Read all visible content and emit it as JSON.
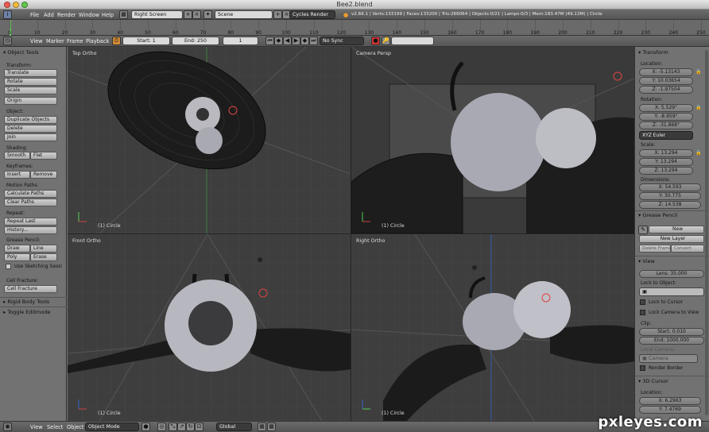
{
  "window": {
    "title": "Bee2.blend"
  },
  "top_menu": [
    "File",
    "Add",
    "Render",
    "Window",
    "Help"
  ],
  "screen_layout": "Right Screen",
  "scene": "Scene",
  "render_engine": "Cycles Render",
  "stats": "v2.66.1 | Verts:133199 | Faces:133200 | Tris:266064 | Objects:0/21 | Lamps:0/3 | Mem:183.47M (49.13M) | Circle",
  "timeline": {
    "ticks": [
      "0",
      "10",
      "20",
      "30",
      "40",
      "50",
      "60",
      "70",
      "80",
      "90",
      "100",
      "110",
      "120",
      "130",
      "140",
      "150",
      "160",
      "170",
      "180",
      "190",
      "200",
      "210",
      "220",
      "230",
      "240",
      "250"
    ],
    "menu": [
      "View",
      "Marker",
      "Frame",
      "Playback"
    ],
    "start": "Start: 1",
    "end": "End: 250",
    "current": "1",
    "sync": "No Sync"
  },
  "toolshelf": {
    "header": "Object Tools",
    "transform_label": "Transform:",
    "translate": "Translate",
    "rotate": "Rotate",
    "scale": "Scale",
    "origin": "Origin",
    "object_label": "Object:",
    "duplicate": "Duplicate Objects",
    "delete": "Delete",
    "join": "Join",
    "shading_label": "Shading:",
    "smooth": "Smooth",
    "flat": "Flat",
    "keyframes_label": "Keyframes:",
    "insert": "Insert",
    "remove": "Remove",
    "motion_label": "Motion Paths:",
    "calc_paths": "Calculate Paths",
    "clear_paths": "Clear Paths",
    "repeat_label": "Repeat:",
    "repeat_last": "Repeat Last",
    "history": "History...",
    "grease_label": "Grease Pencil:",
    "draw": "Draw",
    "line": "Line",
    "poly": "Poly",
    "erase": "Erase",
    "sketch": "Use Sketching Sessi",
    "cell_label": "Cell Fracture:",
    "cell_btn": "Cell Fracture",
    "rigid": "Rigid Body Tools",
    "toggle_edit": "Toggle Editmode"
  },
  "viewports": {
    "tl": {
      "label": "Top Ortho",
      "footer": "(1) Circle"
    },
    "tr": {
      "label": "Camera Persp",
      "footer": "(1) Circle"
    },
    "bl": {
      "label": "Front Ortho",
      "footer": "(1) Circle"
    },
    "br": {
      "label": "Right Ortho",
      "footer": "(1) Circle"
    }
  },
  "properties": {
    "transform_head": "Transform",
    "location_label": "Location:",
    "loc_x": "X: -5.13143",
    "loc_y": "Y: 10.03654",
    "loc_z": "Z: -1.97504",
    "rotation_label": "Rotation:",
    "rot_x": "X: 5.529°",
    "rot_y": "Y: -8.959°",
    "rot_z": "Z: -31.868°",
    "rot_mode": "XYZ Euler",
    "scale_label": "Scale:",
    "sc_x": "X: 13.294",
    "sc_y": "Y: 13.294",
    "sc_z": "Z: 13.294",
    "dim_label": "Dimensions:",
    "dim_x": "X: 54.593",
    "dim_y": "Y: 30.775",
    "dim_z": "Z: 14.538",
    "grease_head": "Grease Pencil",
    "gp_new": "New",
    "gp_new_layer": "New Layer",
    "gp_delete_frame": "Delete Frame",
    "gp_convert": "Convert",
    "view_head": "View",
    "lens": "Lens: 35.000",
    "lock_obj_label": "Lock to Object:",
    "lock_cursor": "Lock to Cursor",
    "lock_camera": "Lock Camera to View",
    "clip_label": "Clip:",
    "clip_start": "Start: 0.010",
    "clip_end": "End: 1000.000",
    "local_camera_label": "Local Camera:",
    "camera": "Camera",
    "render_border": "Render Border",
    "cursor_head": "3D Cursor",
    "cursor_loc_label": "Location:",
    "cur_x": "X: 6.2963",
    "cur_y": "Y: 7.4769"
  },
  "bottom_bar": {
    "menu": [
      "View",
      "Select",
      "Object"
    ],
    "mode": "Object Mode",
    "orientation": "Global"
  },
  "watermark": "pxleyes.com"
}
